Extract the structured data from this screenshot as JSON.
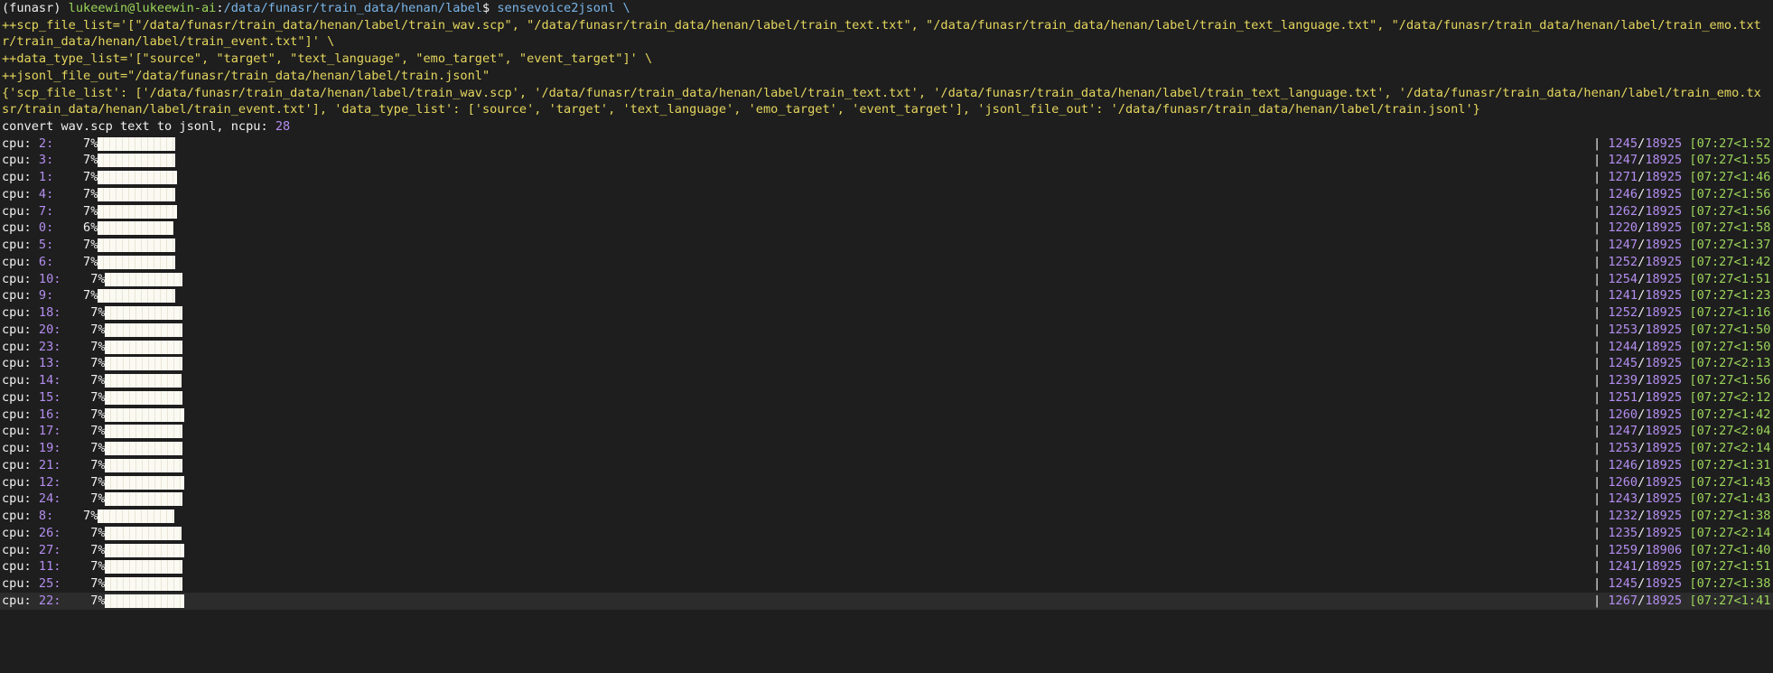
{
  "terminal": {
    "prompt": {
      "env": "(funasr) ",
      "user_host": "lukeewin@lukeewin-ai",
      "sep": ":",
      "path": "/data/funasr/train_data/henan/label",
      "dollar": "$ ",
      "command": "sensevoice2jsonl \\"
    },
    "lines": [
      {
        "text": "++scp_file_list='[\"/data/funasr/train_data/henan/label/train_wav.scp\", \"/data/funasr/train_data/henan/label/train_text.txt\", \"/data/funasr/train_data/henan/label/train_text_language.txt\", \"/data/funasr/train_data/henan/label/train_emo.txt",
        "color": "yellow"
      },
      {
        "text": "r/train_data/henan/label/train_event.txt\"]' \\",
        "color": "yellow"
      },
      {
        "text": "++data_type_list='[\"source\", \"target\", \"text_language\", \"emo_target\", \"event_target\"]' \\",
        "color": "yellow"
      },
      {
        "text": "++jsonl_file_out=\"/data/funasr/train_data/henan/label/train.jsonl\"",
        "color": "yellow"
      },
      {
        "text": "{'scp_file_list': ['/data/funasr/train_data/henan/label/train_wav.scp', '/data/funasr/train_data/henan/label/train_text.txt', '/data/funasr/train_data/henan/label/train_text_language.txt', '/data/funasr/train_data/henan/label/train_emo.tx",
        "color": "yellow"
      },
      {
        "text": "sr/train_data/henan/label/train_event.txt'], 'data_type_list': ['source', 'target', 'text_language', 'emo_target', 'event_target'], 'jsonl_file_out': '/data/funasr/train_data/henan/label/train.jsonl'}",
        "color": "yellow"
      }
    ],
    "convert_line": {
      "text": "convert wav.scp text to jsonl, ncpu: ",
      "ncpu": "28"
    },
    "progress": [
      {
        "cpu": "2",
        "pct": "7%",
        "done": "1245",
        "total": "18925",
        "time": "[07:27<1:52",
        "fill": 0.066
      },
      {
        "cpu": "3",
        "pct": "7%",
        "done": "1247",
        "total": "18925",
        "time": "[07:27<1:55",
        "fill": 0.066
      },
      {
        "cpu": "1",
        "pct": "7%",
        "done": "1271",
        "total": "18925",
        "time": "[07:27<1:46",
        "fill": 0.067
      },
      {
        "cpu": "4",
        "pct": "7%",
        "done": "1246",
        "total": "18925",
        "time": "[07:27<1:56",
        "fill": 0.066
      },
      {
        "cpu": "7",
        "pct": "7%",
        "done": "1262",
        "total": "18925",
        "time": "[07:27<1:56",
        "fill": 0.067
      },
      {
        "cpu": "0",
        "pct": "6%",
        "done": "1220",
        "total": "18925",
        "time": "[07:27<1:58",
        "fill": 0.064
      },
      {
        "cpu": "5",
        "pct": "7%",
        "done": "1247",
        "total": "18925",
        "time": "[07:27<1:37",
        "fill": 0.066
      },
      {
        "cpu": "6",
        "pct": "7%",
        "done": "1252",
        "total": "18925",
        "time": "[07:27<1:42",
        "fill": 0.066
      },
      {
        "cpu": "10",
        "pct": "7%",
        "done": "1254",
        "total": "18925",
        "time": "[07:27<1:51",
        "fill": 0.066
      },
      {
        "cpu": "9",
        "pct": "7%",
        "done": "1241",
        "total": "18925",
        "time": "[07:27<1:23",
        "fill": 0.066
      },
      {
        "cpu": "18",
        "pct": "7%",
        "done": "1252",
        "total": "18925",
        "time": "[07:27<1:16",
        "fill": 0.066
      },
      {
        "cpu": "20",
        "pct": "7%",
        "done": "1253",
        "total": "18925",
        "time": "[07:27<1:50",
        "fill": 0.066
      },
      {
        "cpu": "23",
        "pct": "7%",
        "done": "1244",
        "total": "18925",
        "time": "[07:27<1:50",
        "fill": 0.066
      },
      {
        "cpu": "13",
        "pct": "7%",
        "done": "1245",
        "total": "18925",
        "time": "[07:27<2:13",
        "fill": 0.066
      },
      {
        "cpu": "14",
        "pct": "7%",
        "done": "1239",
        "total": "18925",
        "time": "[07:27<1:56",
        "fill": 0.065
      },
      {
        "cpu": "15",
        "pct": "7%",
        "done": "1251",
        "total": "18925",
        "time": "[07:27<2:12",
        "fill": 0.066
      },
      {
        "cpu": "16",
        "pct": "7%",
        "done": "1260",
        "total": "18925",
        "time": "[07:27<1:42",
        "fill": 0.067
      },
      {
        "cpu": "17",
        "pct": "7%",
        "done": "1247",
        "total": "18925",
        "time": "[07:27<2:04",
        "fill": 0.066
      },
      {
        "cpu": "19",
        "pct": "7%",
        "done": "1253",
        "total": "18925",
        "time": "[07:27<2:14",
        "fill": 0.066
      },
      {
        "cpu": "21",
        "pct": "7%",
        "done": "1246",
        "total": "18925",
        "time": "[07:27<1:31",
        "fill": 0.066
      },
      {
        "cpu": "12",
        "pct": "7%",
        "done": "1260",
        "total": "18925",
        "time": "[07:27<1:43",
        "fill": 0.067
      },
      {
        "cpu": "24",
        "pct": "7%",
        "done": "1243",
        "total": "18925",
        "time": "[07:27<1:43",
        "fill": 0.066
      },
      {
        "cpu": "8",
        "pct": "7%",
        "done": "1232",
        "total": "18925",
        "time": "[07:27<1:38",
        "fill": 0.065
      },
      {
        "cpu": "26",
        "pct": "7%",
        "done": "1235",
        "total": "18925",
        "time": "[07:27<2:14",
        "fill": 0.065
      },
      {
        "cpu": "27",
        "pct": "7%",
        "done": "1259",
        "total": "18906",
        "time": "[07:27<1:40",
        "fill": 0.067
      },
      {
        "cpu": "11",
        "pct": "7%",
        "done": "1241",
        "total": "18925",
        "time": "[07:27<1:51",
        "fill": 0.066
      },
      {
        "cpu": "25",
        "pct": "7%",
        "done": "1245",
        "total": "18925",
        "time": "[07:27<1:38",
        "fill": 0.066
      },
      {
        "cpu": "22",
        "pct": "7%",
        "done": "1267",
        "total": "18925",
        "time": "[07:27<1:41",
        "fill": 0.067
      }
    ],
    "colors": {
      "background": "#1e1e1e",
      "prompt_user": "#9bd45a",
      "prompt_path": "#7ab5e8",
      "output_text": "#e5d65d",
      "count": "#b48ef0",
      "time": "#9bd45a",
      "bar_fill": "#fbfaf2"
    }
  }
}
